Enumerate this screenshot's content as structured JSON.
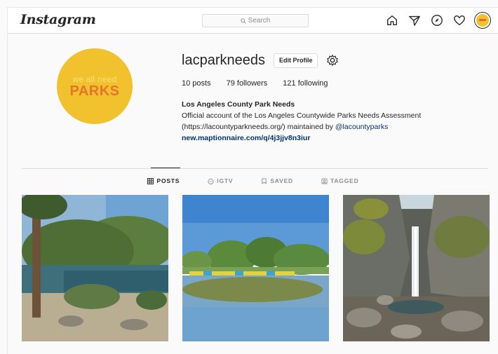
{
  "nav": {
    "logo": "Instagram",
    "search_placeholder": "Search",
    "icons": [
      "home-icon",
      "direct-icon",
      "explore-icon",
      "activity-icon",
      "avatar"
    ]
  },
  "profile": {
    "username": "lacparkneeds",
    "edit_label": "Edit Profile",
    "avatar_text_small": "we all need",
    "avatar_text_big": "PARKS",
    "stats": {
      "posts": "10 posts",
      "followers": "79 followers",
      "following": "121 following"
    },
    "bio": {
      "full_name": "Los Angeles County Park Needs",
      "line1": "Official account of the Los Angeles Countywide Parks Needs Assessment",
      "line2_prefix": "(https://lacountyparkneeds.org/) maintained by ",
      "mention": "@lacountyparks",
      "website": "new.maptionnaire.com/q/4j3jjv8n3iur"
    }
  },
  "tabs": [
    {
      "label": "POSTS",
      "icon": "grid-icon",
      "active": true
    },
    {
      "label": "IGTV",
      "icon": "igtv-icon",
      "active": false
    },
    {
      "label": "SAVED",
      "icon": "bookmark-icon",
      "active": false
    },
    {
      "label": "TAGGED",
      "icon": "tag-icon",
      "active": false
    }
  ],
  "colors": {
    "brand_yellow": "#f2c12e",
    "brand_orange": "#e8732b",
    "link": "#003569"
  },
  "posts": [
    {
      "subject": "park lake with palm tree"
    },
    {
      "subject": "lake with paddle boats"
    },
    {
      "subject": "waterfall in canyon"
    }
  ]
}
